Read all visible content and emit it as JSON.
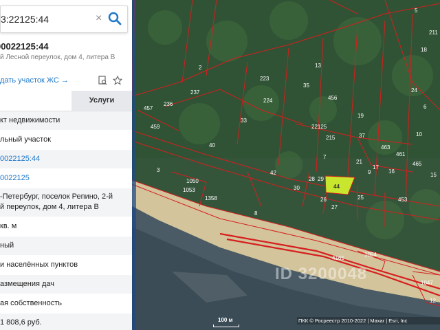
{
  "search": {
    "value": "3:22125:44"
  },
  "object": {
    "title": "00022125:44",
    "subtitle": "й Лесной переулок, дом 4, литера В",
    "zhs_link": "дать участок ЖС →"
  },
  "tabs": {
    "services": "Услуги"
  },
  "rows": [
    "кт недвижимости",
    "льный участок",
    "0022125:44",
    "0022125",
    "-Петербург, поселок Репино, 2-й",
    "й переулок, дом 4, литера В",
    "кв. м",
    "ный",
    "и населённых пунктов",
    "азмещения дач",
    "ая собственность",
    "1 808,6 руб."
  ],
  "map": {
    "parcel_labels": [
      "2",
      "3",
      "5",
      "6",
      "7",
      "8",
      "9",
      "10",
      "13",
      "15",
      "16",
      "17",
      "18",
      "19",
      "21",
      "24",
      "25",
      "26",
      "27",
      "28",
      "29",
      "30",
      "33",
      "35",
      "37",
      "40",
      "42",
      "44",
      "215",
      "223",
      "224",
      "236",
      "237",
      "453",
      "456",
      "457",
      "459",
      "461",
      "463",
      "465",
      "1050",
      "1053",
      "1054",
      "1358",
      "4165",
      "22125",
      "1047",
      "211",
      "12"
    ],
    "selected_parcel": "44",
    "colors": {
      "boundary": "#d61e1e",
      "selected_fill": "#c8e62d",
      "water": "#4a5a68",
      "forest": "#3a5a3a",
      "beach": "#d8c7a0"
    },
    "scale_label": "100 м",
    "attribution": "ПКК © Росреестр 2010-2022 | Maxar | Esri, Inc",
    "watermark": "ID 3200048"
  }
}
